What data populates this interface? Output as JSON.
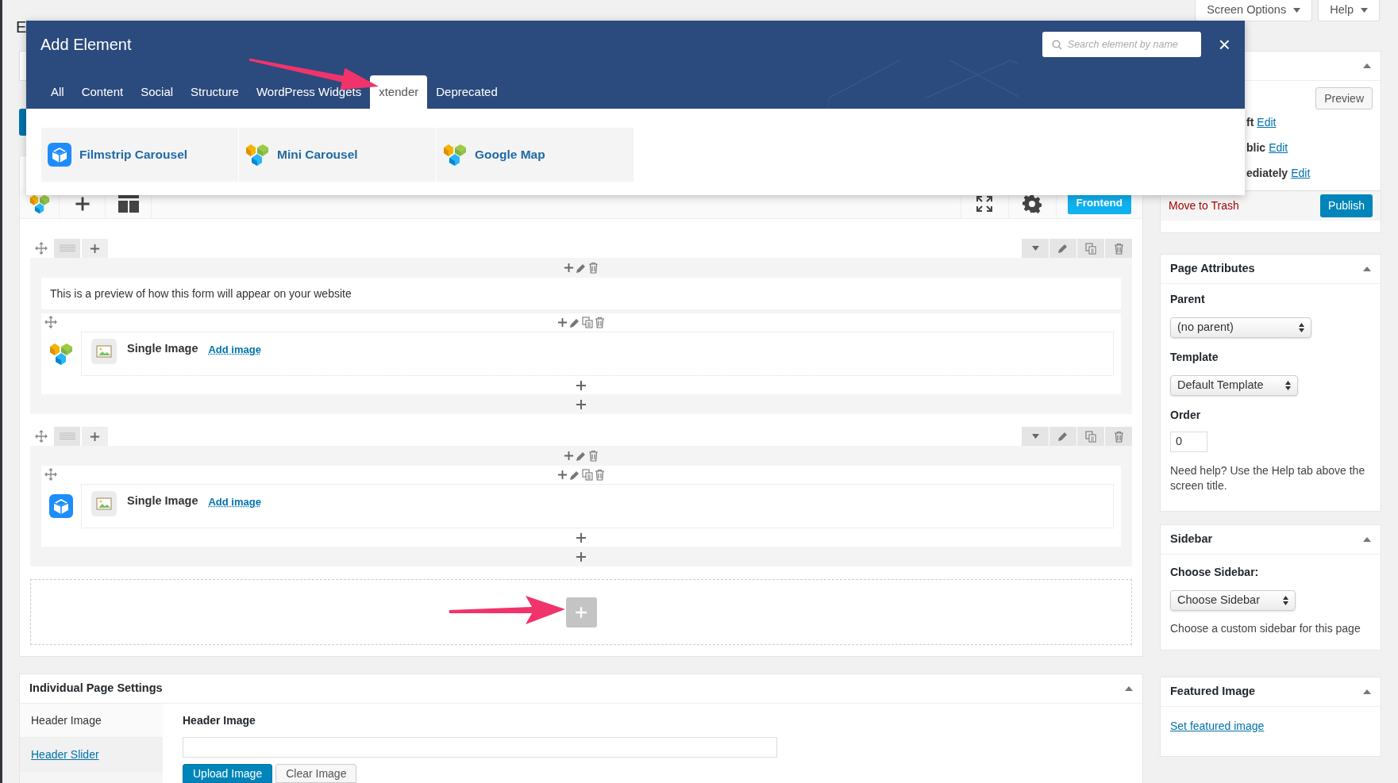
{
  "page": {
    "title": "E"
  },
  "screen_meta": [
    {
      "label": "Screen Options"
    },
    {
      "label": "Help"
    }
  ],
  "modal": {
    "title": "Add Element",
    "search": {
      "placeholder": "Search element by name"
    },
    "close": "×",
    "tabs": [
      {
        "label": "All",
        "selected": false
      },
      {
        "label": "Content",
        "selected": false
      },
      {
        "label": "Social",
        "selected": false
      },
      {
        "label": "Structure",
        "selected": false
      },
      {
        "label": "WordPress Widgets",
        "selected": false
      },
      {
        "label": "xtender",
        "selected": true
      },
      {
        "label": "Deprecated",
        "selected": false
      }
    ],
    "elements": [
      {
        "label": "Filmstrip Carousel",
        "logo": {
          "kind": "box"
        }
      },
      {
        "label": "Mini Carousel",
        "logo": {
          "kind": "cubes"
        }
      },
      {
        "label": "Google Map",
        "logo": {
          "kind": "cubes"
        }
      }
    ]
  },
  "builder": {
    "frontend_button": "Frontend",
    "rows": [
      {
        "blocks": [
          {
            "kind": "text",
            "text": "This is a preview of how this form will appear on your website"
          },
          {
            "kind": "element",
            "title": "Single Image",
            "link": "Add image",
            "logo": {
              "kind": "cubes"
            }
          }
        ]
      },
      {
        "blocks": [
          {
            "kind": "element",
            "title": "Single Image",
            "link": "Add image",
            "logo": {
              "kind": "box"
            }
          }
        ]
      }
    ]
  },
  "page_settings": {
    "title": "Individual Page Settings",
    "tabs": [
      {
        "label": "Header Image",
        "selected": true
      },
      {
        "label": "Header Slider",
        "selected": false
      }
    ],
    "field_label": "Header Image",
    "buttons": [
      "Upload Image",
      "Clear Image"
    ]
  },
  "publish": {
    "preview": "Preview",
    "lines": [
      {
        "text": "ft",
        "link": "Edit"
      },
      {
        "text": "blic",
        "link": "Edit"
      },
      {
        "text": "ediately",
        "link": "Edit"
      }
    ],
    "trash": "Move to Trash",
    "publish": "Publish"
  },
  "page_attributes": {
    "title": "Page Attributes",
    "parent_label": "Parent",
    "parent": "(no parent)",
    "template_label": "Template",
    "template": "Default Template",
    "order_label": "Order",
    "order": "0",
    "help": "Need help? Use the Help tab above the screen title."
  },
  "sidebar": {
    "title": "Sidebar",
    "label": "Choose Sidebar:",
    "select": "Choose Sidebar",
    "help": "Choose a custom sidebar for this page"
  },
  "featured_image": {
    "title": "Featured Image",
    "link": "Set featured image"
  }
}
